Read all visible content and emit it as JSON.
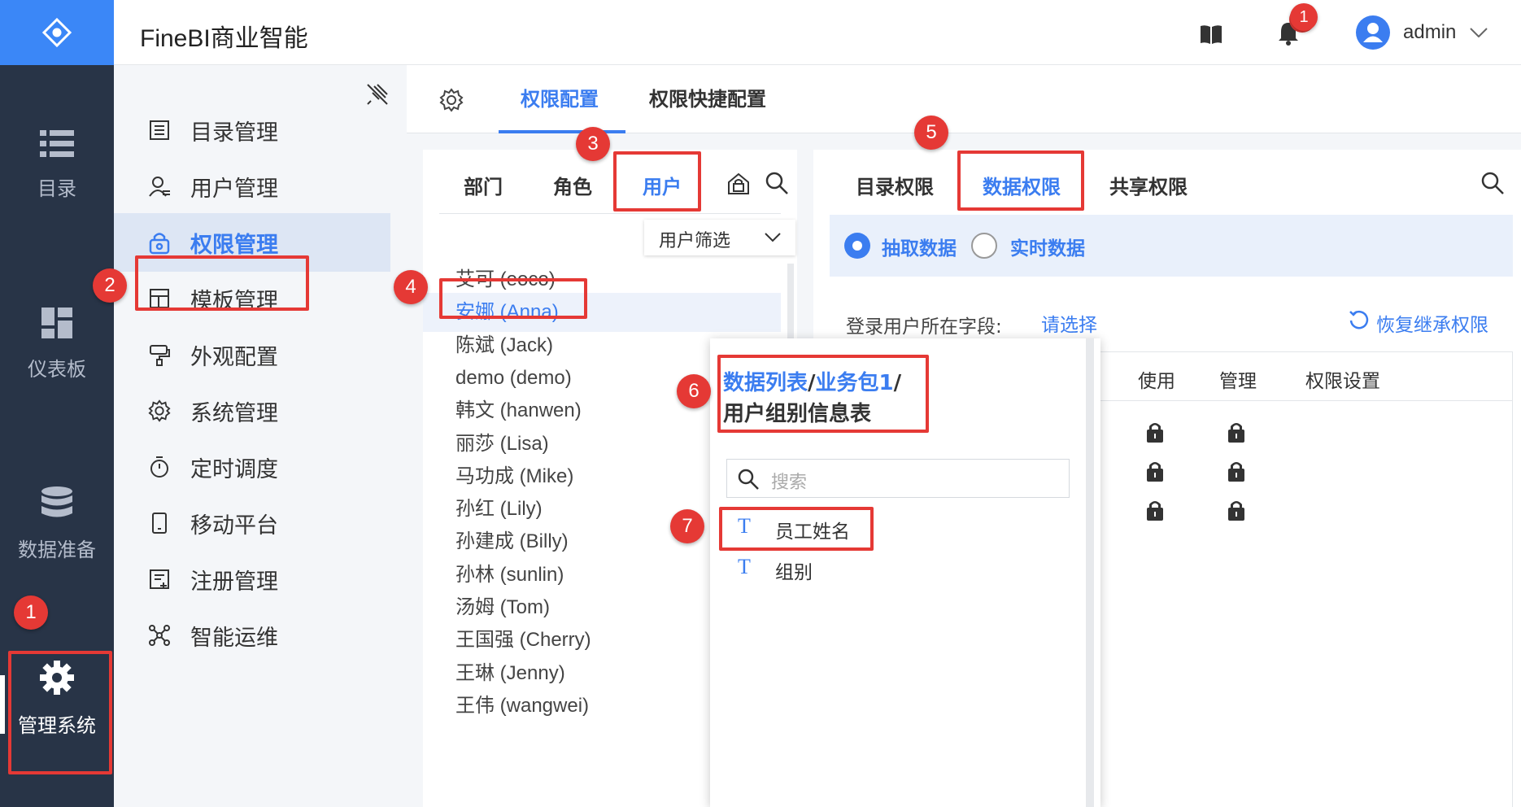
{
  "app": {
    "title": "FineBI商业智能",
    "user": "admin",
    "notification_count": "1"
  },
  "leftnav": {
    "items": [
      {
        "label": "目录",
        "icon": "list-icon"
      },
      {
        "label": "仪表板",
        "icon": "dashboard-icon"
      },
      {
        "label": "数据准备",
        "icon": "database-icon"
      },
      {
        "label": "管理系统",
        "icon": "gear-icon"
      }
    ]
  },
  "subnav": {
    "items": [
      {
        "label": "目录管理",
        "icon": "directory-icon"
      },
      {
        "label": "用户管理",
        "icon": "user-icon"
      },
      {
        "label": "权限管理",
        "icon": "lock-icon",
        "active": true
      },
      {
        "label": "模板管理",
        "icon": "template-icon"
      },
      {
        "label": "外观配置",
        "icon": "brush-icon"
      },
      {
        "label": "系统管理",
        "icon": "gear-icon"
      },
      {
        "label": "定时调度",
        "icon": "timer-icon"
      },
      {
        "label": "移动平台",
        "icon": "mobile-icon"
      },
      {
        "label": "注册管理",
        "icon": "register-icon"
      },
      {
        "label": "智能运维",
        "icon": "ops-icon"
      }
    ]
  },
  "main": {
    "tabs": [
      "权限配置",
      "权限快捷配置"
    ],
    "user_panel": {
      "tabs": [
        "部门",
        "角色",
        "用户"
      ],
      "filter_label": "用户筛选",
      "users": [
        "艾可 (eoco)",
        "安娜 (Anna)",
        "陈斌 (Jack)",
        "demo (demo)",
        "韩文 (hanwen)",
        "丽莎 (Lisa)",
        "马功成 (Mike)",
        "孙红 (Lily)",
        "孙建成 (Billy)",
        "孙林 (sunlin)",
        "汤姆 (Tom)",
        "王国强 (Cherry)",
        "王琳 (Jenny)",
        "王伟 (wangwei)"
      ],
      "selected_user": "安娜 (Anna)"
    },
    "perm_panel": {
      "tabs": [
        "目录权限",
        "数据权限",
        "共享权限"
      ],
      "radio_extract": "抽取数据",
      "radio_realtime": "实时数据",
      "field_label": "登录用户所在字段:",
      "field_value": "请选择",
      "restore_label": "恢复继承权限",
      "columns": [
        "使用",
        "管理",
        "权限设置"
      ]
    },
    "popup": {
      "path_part1": "数据列表",
      "sep1": "/",
      "path_part2": "业务包1",
      "sep2": "/",
      "path_part3": "用户组别信息表",
      "search_placeholder": "搜索",
      "fields": [
        "员工姓名",
        "组别"
      ]
    }
  },
  "annotations": [
    "1",
    "1",
    "2",
    "3",
    "4",
    "5",
    "6",
    "7"
  ],
  "colors": {
    "accent": "#3b7df0",
    "nav_bg": "#283447",
    "logo_bg": "#3b87f7",
    "highlight": "#e53935"
  }
}
